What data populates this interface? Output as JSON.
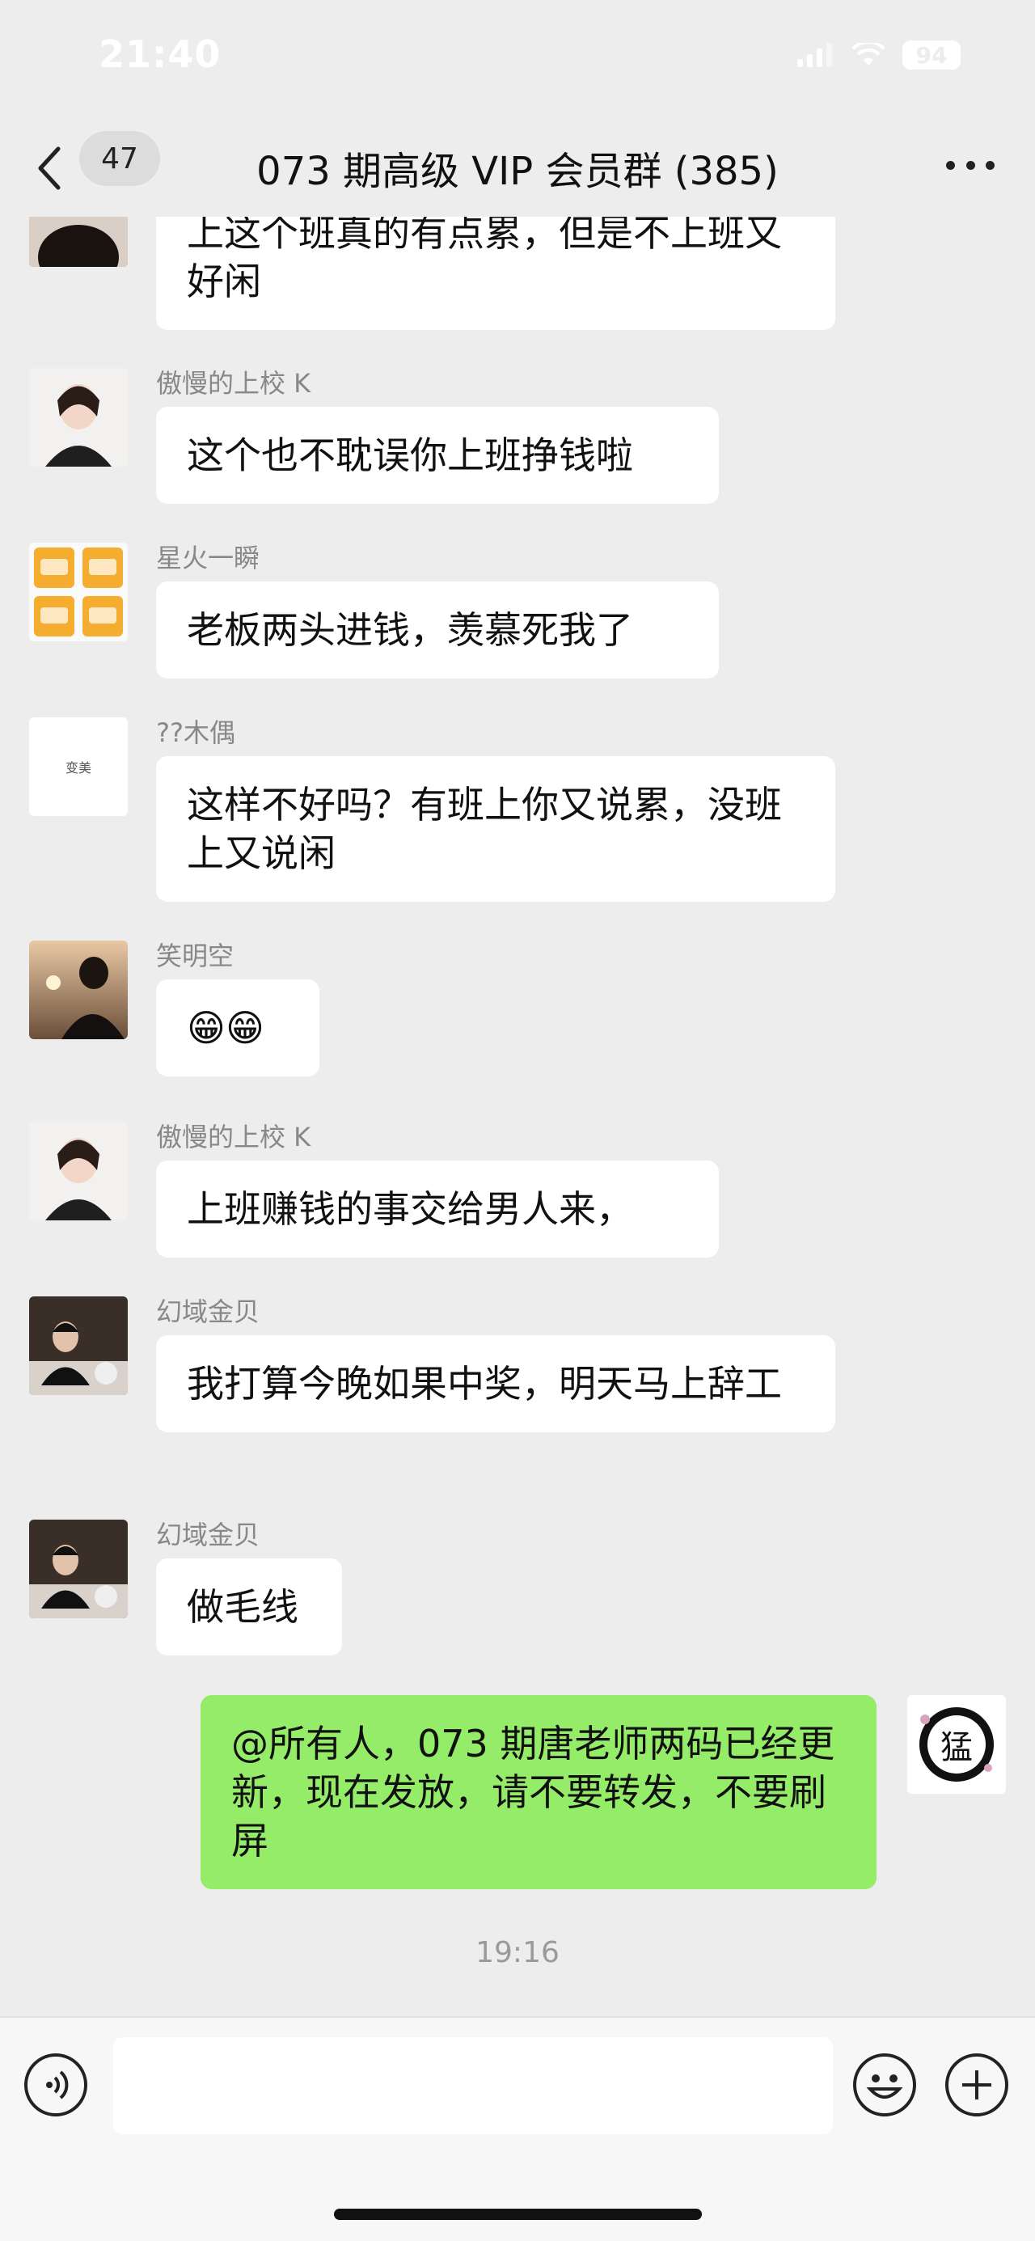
{
  "status": {
    "time": "21:40",
    "battery": "94"
  },
  "header": {
    "unread_count": "47",
    "title": "073 期高级 VIP 会员群 (385)"
  },
  "messages": [
    {
      "sender": "",
      "text": "上这个班真的有点累，但是不上班又好闲"
    },
    {
      "sender": "傲慢的上校 K",
      "text": "这个也不耽误你上班挣钱啦"
    },
    {
      "sender": "星火一瞬",
      "text": "老板两头进钱，羡慕死我了"
    },
    {
      "sender": "??木偶",
      "avatar_text": "变美",
      "text": "这样不好吗？有班上你又说累，没班上又说闲"
    },
    {
      "sender": "笑明空",
      "text": "😁😁"
    },
    {
      "sender": "傲慢的上校 K",
      "text": "上班赚钱的事交给男人来，"
    },
    {
      "sender": "幻域金贝",
      "text": "我打算今晚如果中奖，明天马上辞工"
    },
    {
      "sender": "幻域金贝",
      "text": "做毛线"
    }
  ],
  "self_message": {
    "text": "@所有人，073 期唐老师两码已经更新，现在发放，请不要转发，不要刷屏",
    "avatar_char": "猛"
  },
  "timestamp": "19:16",
  "input": {
    "placeholder": ""
  },
  "colors": {
    "background": "#ededed",
    "self_bubble": "#95ec69",
    "bubble": "#ffffff"
  }
}
